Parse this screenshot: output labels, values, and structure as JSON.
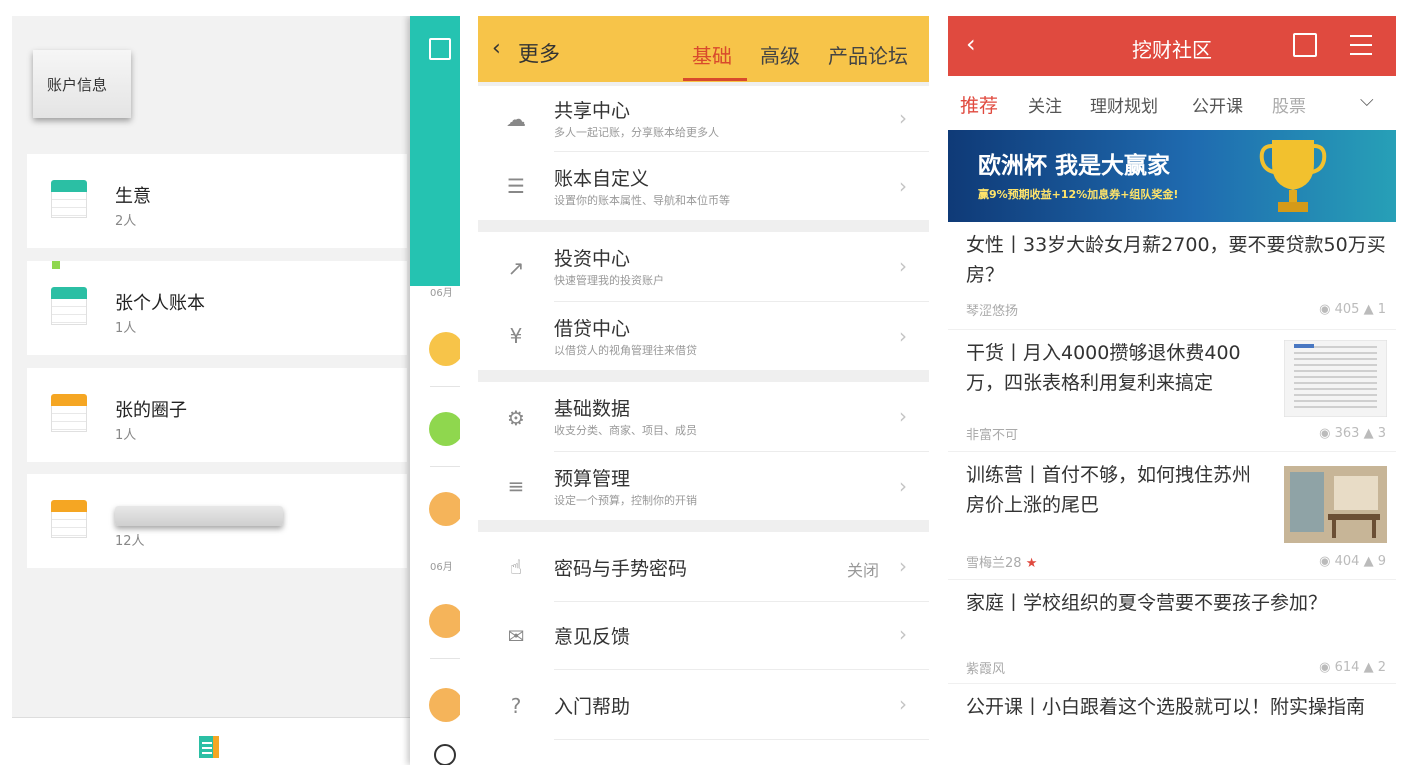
{
  "panel1": {
    "account_info_label": "账户信息",
    "books": [
      {
        "name": "生意",
        "count": "2人",
        "color": "#2bbfa4"
      },
      {
        "name": "张个人账本",
        "count": "1人",
        "color": "#2bbfa4"
      },
      {
        "name": "张的圈子",
        "count": "1人",
        "color": "#f5a623"
      },
      {
        "name": "",
        "count": "12人",
        "color": "#f5a623"
      }
    ],
    "dates": [
      "06月",
      "06月"
    ],
    "bottom_tab_label": "记账"
  },
  "panel2": {
    "back_label": "更多",
    "tabs": [
      "基础",
      "高级",
      "产品论坛"
    ],
    "active_tab": "基础",
    "accent_color": "#f7c449",
    "rows": [
      {
        "title": "共享中心",
        "sub": "多人一起记账，分享账本给更多人",
        "icon": "cloud-upload-icon"
      },
      {
        "title": "账本自定义",
        "sub": "设置你的账本属性、导航和本位币等",
        "icon": "book-settings-icon"
      },
      {
        "title": "投资中心",
        "sub": "快速管理我的投资账户",
        "icon": "chart-growth-icon"
      },
      {
        "title": "借贷中心",
        "sub": "以借贷人的视角管理往来借贷",
        "icon": "money-bag-icon"
      },
      {
        "title": "基础数据",
        "sub": "收支分类、商家、项目、成员",
        "icon": "data-settings-icon"
      },
      {
        "title": "预算管理",
        "sub": "设定一个预算，控制你的开销",
        "icon": "sliders-icon"
      },
      {
        "title": "密码与手势密码",
        "status": "关闭",
        "icon": "password-gesture-icon"
      },
      {
        "title": "意见反馈",
        "icon": "feedback-icon"
      },
      {
        "title": "入门帮助",
        "icon": "help-icon"
      }
    ]
  },
  "panel3": {
    "title": "挖财社区",
    "accent_color": "#e04a3f",
    "tabs": [
      "推荐",
      "关注",
      "理财规划",
      "公开课",
      "股票"
    ],
    "active_tab": "推荐",
    "banner": {
      "title": "欧洲杯  我是大赢家",
      "sub": "赢9%预期收益+12%加息券+组队奖金!"
    },
    "posts": [
      {
        "title": "女性丨33岁大龄女月薪2700，要不要贷款50万买房？",
        "author": "琴涩悠扬",
        "views": "405",
        "likes": "1"
      },
      {
        "title": "干货丨月入4000攒够退休费400万，四张表格利用复利来搞定",
        "author": "非富不可",
        "views": "363",
        "likes": "3"
      },
      {
        "title": "训练营丨首付不够，如何拽住苏州房价上涨的尾巴",
        "author": "雪梅兰28",
        "views": "404",
        "likes": "9"
      },
      {
        "title": "家庭丨学校组织的夏令营要不要孩子参加？",
        "author": "紫霞风",
        "views": "614",
        "likes": "2"
      },
      {
        "title": "公开课丨小白跟着这个选股就可以！附实操指南"
      }
    ]
  }
}
